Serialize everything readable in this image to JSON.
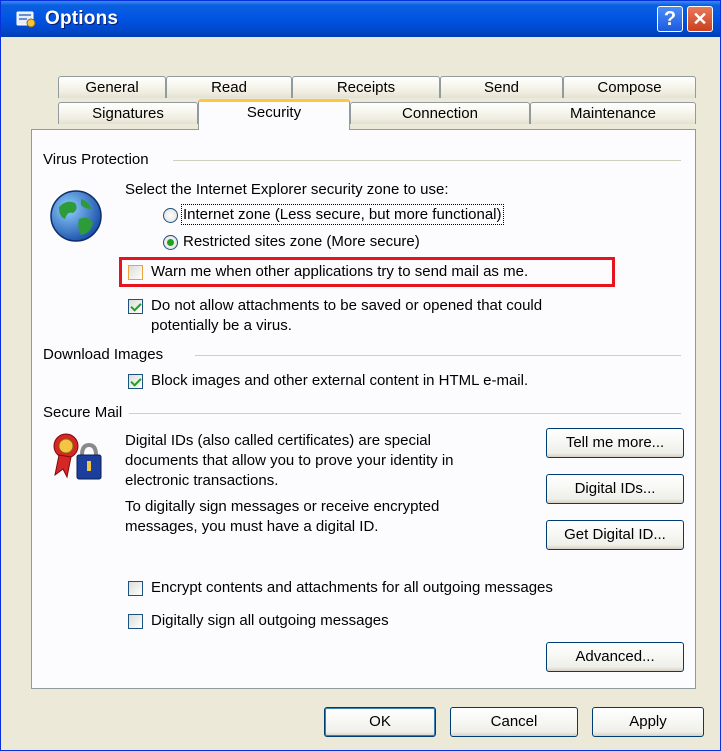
{
  "window": {
    "title": "Options",
    "help_label": "?",
    "close_label": "✕",
    "icon": "options-dialog-icon"
  },
  "tabs": {
    "row1": [
      "General",
      "Read",
      "Receipts",
      "Send",
      "Compose"
    ],
    "row2": [
      "Signatures",
      "Security",
      "Connection",
      "Maintenance"
    ],
    "active": "Security"
  },
  "virus": {
    "group": "Virus Protection",
    "zone_prompt": "Select the Internet Explorer security zone to use:",
    "internet_zone": "Internet zone (Less secure, but more functional)",
    "internet_zone_selected": false,
    "restricted_zone": "Restricted sites zone (More secure)",
    "restricted_zone_selected": true,
    "warn_mail": "Warn me when other applications try to send mail as me.",
    "warn_mail_checked": false,
    "no_attach_line1": "Do not allow attachments to be saved or opened that could",
    "no_attach_line2": "potentially be a virus.",
    "no_attach_checked": true
  },
  "download": {
    "group": "Download Images",
    "block_images": "Block images and other external content in HTML e-mail.",
    "block_images_checked": true
  },
  "secure": {
    "group": "Secure Mail",
    "desc1_l1": "Digital IDs (also called certificates) are special",
    "desc1_l2": "documents that allow you to prove your identity in",
    "desc1_l3": "electronic transactions.",
    "desc2_l1": "To digitally sign messages or receive encrypted",
    "desc2_l2": "messages, you must have a digital ID.",
    "tell_more": "Tell me more...",
    "digital_ids": "Digital IDs...",
    "get_id": "Get Digital ID...",
    "encrypt": "Encrypt contents and attachments for all outgoing messages",
    "encrypt_checked": false,
    "sign": "Digitally sign all outgoing messages",
    "sign_checked": false,
    "advanced": "Advanced..."
  },
  "footer": {
    "ok": "OK",
    "cancel": "Cancel",
    "apply": "Apply"
  },
  "colors": {
    "titlebar": "#0054e3",
    "face": "#ece9d8",
    "panel": "#fcfcfe",
    "check_mark": "#21a121",
    "highlight": "#e6141c",
    "active_tab_accent": "#ffc83c"
  }
}
